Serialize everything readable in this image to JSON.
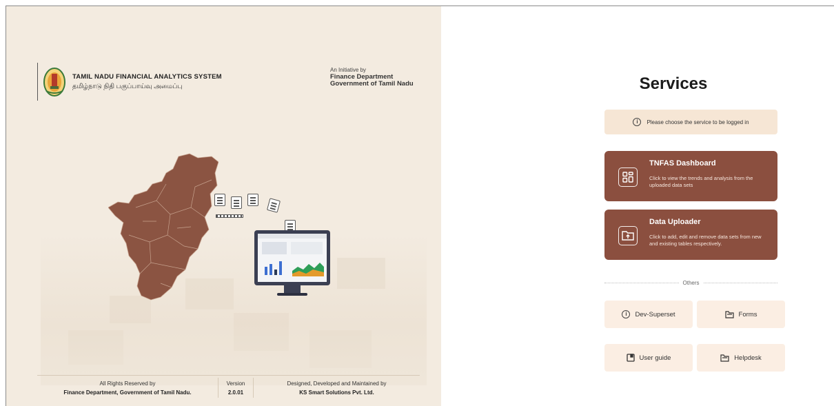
{
  "left_panel": {
    "system_title_en": "TAMIL NADU FINANCIAL ANALYTICS SYSTEM",
    "system_title_ta": "தமிழ்நாடு நிதி பகுப்பாய்வு அமைப்பு",
    "initiative_label": "An Initiative by",
    "initiative_dept": "Finance Department",
    "initiative_gov": "Government of Tamil Nadu",
    "footer": {
      "rights_label": "All Rights Reserved by",
      "rights_owner": "Finance Department, Government of Tamil Nadu.",
      "version_label": "Version",
      "version_value": "2.0.01",
      "designer_label": "Designed, Developed and Maintained by",
      "designer_name": "KS Smart Solutions Pvt. Ltd."
    }
  },
  "services": {
    "title": "Services",
    "info_text": "Please choose the service to be logged in",
    "cards": [
      {
        "title": "TNFAS Dashboard",
        "desc": "Click to view the trends and analysis from the uploaded data sets",
        "icon": "dashboard-grid-icon"
      },
      {
        "title": "Data Uploader",
        "desc": "Click to add, edit and remove data sets from new and existing tables respectively.",
        "icon": "folder-upload-icon"
      }
    ],
    "others_label": "Others",
    "others": [
      {
        "label": "Dev-Superset",
        "icon": "info-icon"
      },
      {
        "label": "Forms",
        "icon": "folder-icon"
      },
      {
        "label": "User guide",
        "icon": "book-icon"
      },
      {
        "label": "Helpdesk",
        "icon": "folder-icon"
      }
    ]
  },
  "colors": {
    "left_bg": "#f3ebe0",
    "card_bg": "#8b4f3f",
    "info_bg": "#f6e6d5",
    "small_bg": "#fbeee3",
    "map_fill": "#8b5442"
  }
}
